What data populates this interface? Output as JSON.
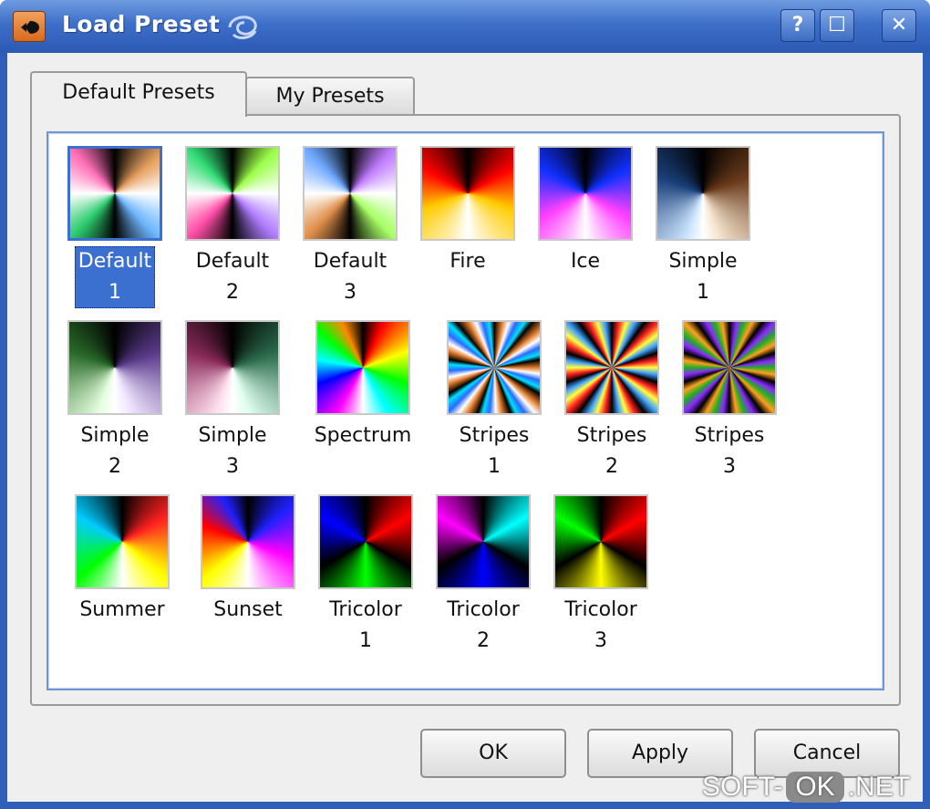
{
  "window": {
    "title": "Load Preset",
    "help_label": "?",
    "maximize_label": "☐",
    "close_label": "✕",
    "icons": [
      "app-icon",
      "swirl-icon"
    ]
  },
  "tabs": [
    {
      "label": "Default Presets",
      "active": true
    },
    {
      "label": "My Presets",
      "active": false
    }
  ],
  "presets": [
    {
      "name": "Default\n1",
      "selected": true,
      "gradient": "conic-gradient(from 0deg,#000 0deg,#e6a060 50deg,#fff 90deg,#6fb7ff 135deg,#000 180deg,#2ecc71 225deg,#fff 270deg,#ff6fb7 315deg,#000 360deg)"
    },
    {
      "name": "Default\n2",
      "selected": false,
      "gradient": "conic-gradient(from 0deg,#000 0deg,#9cff4a 45deg,#fff 90deg,#b07cff 135deg,#000 180deg,#ff4fa8 225deg,#fff 270deg,#33dd77 315deg,#000 360deg)"
    },
    {
      "name": "Default\n3",
      "selected": false,
      "gradient": "conic-gradient(from 0deg,#000 0deg,#c07cff 45deg,#fff 90deg,#a8ff66 135deg,#000 180deg,#e0904a 225deg,#fff 270deg,#6fa8ff 315deg,#000 360deg)"
    },
    {
      "name": "Fire",
      "selected": false,
      "gradient": "conic-gradient(from 0deg,#000 0deg,#ff0000 60deg,#ffcc00 110deg,#fff 180deg,#ffcc00 250deg,#ff0000 300deg,#000 360deg)"
    },
    {
      "name": "Ice",
      "selected": false,
      "gradient": "conic-gradient(from 0deg,#000 0deg,#1030ff 60deg,#ff40ff 120deg,#fff 180deg,#ff40ff 240deg,#1030ff 300deg,#000 360deg)"
    },
    {
      "name": "Simple\n1",
      "selected": false,
      "gradient": "conic-gradient(from 0deg,#000 0deg,#6a3a1a 70deg,#f6e6d0 160deg,#fff 180deg,#cde6ff 200deg,#1a3f7a 290deg,#000 360deg)"
    },
    {
      "name": "Simple\n2",
      "selected": false,
      "gradient": "conic-gradient(from 0deg,#000 0deg,#5a3a8a 70deg,#f0e6ff 160deg,#fff 180deg,#e6ffe0 200deg,#2a6a2a 290deg,#000 360deg)"
    },
    {
      "name": "Simple\n3",
      "selected": false,
      "gradient": "conic-gradient(from 0deg,#000 0deg,#2a6a4a 70deg,#e0fff0 160deg,#fff 180deg,#ffe0ee 200deg,#8a2a5a 290deg,#000 360deg)"
    },
    {
      "name": "Spectrum",
      "selected": false,
      "gradient": "conic-gradient(from 0deg,#000 0deg,#ff0000 25deg,#ffff00 70deg,#00ff00 110deg,#00ffff 150deg,#fff 180deg,#ff00ff 210deg,#0000ff 250deg,#00ffff 280deg,#00ff00 310deg,#ff8800 335deg,#000 360deg)"
    },
    {
      "name": "Stripes\n1",
      "selected": false,
      "gradient": "repeating-conic-gradient(from 0deg,#000 0deg,#e07a2a 10deg,#fff 18deg,#2a6aff 26deg,#00e0ff 34deg,#000 40deg)"
    },
    {
      "name": "Stripes\n2",
      "selected": false,
      "gradient": "repeating-conic-gradient(from 0deg,#000 0deg,#ff2020 9deg,#ffff40 18deg,#40a0ff 27deg,#000 36deg)"
    },
    {
      "name": "Stripes\n3",
      "selected": false,
      "gradient": "repeating-conic-gradient(from 0deg,#000 0deg,#8a2aff 9deg,#20b020 18deg,#ffa020 27deg,#000 36deg)"
    },
    {
      "name": "Summer",
      "selected": false,
      "gradient": "conic-gradient(from 0deg,#000 0deg,#ff2020 60deg,#ffff00 130deg,#fff 180deg,#00ff00 230deg,#00ccff 300deg,#000 360deg)"
    },
    {
      "name": "Sunset",
      "selected": false,
      "gradient": "conic-gradient(from 0deg,#000 0deg,#2020ff 50deg,#ff00ff 110deg,#fff 180deg,#ffff00 230deg,#ff0000 290deg,#2020ff 330deg,#000 360deg)"
    },
    {
      "name": "Tricolor\n1",
      "selected": false,
      "gradient": "conic-gradient(from 0deg,#000 0deg,#ff0000 60deg,#000 120deg,#00ff00 180deg,#000 240deg,#0000ff 300deg,#000 360deg)"
    },
    {
      "name": "Tricolor\n2",
      "selected": false,
      "gradient": "conic-gradient(from 0deg,#000 0deg,#00ffff 60deg,#000 120deg,#0000ff 180deg,#000 240deg,#ff00ff 300deg,#000 360deg)"
    },
    {
      "name": "Tricolor\n3",
      "selected": false,
      "gradient": "conic-gradient(from 0deg,#000 0deg,#ff0000 60deg,#000 120deg,#ffff00 180deg,#000 240deg,#00ff00 300deg,#000 360deg)"
    }
  ],
  "buttons": {
    "ok": "OK",
    "apply": "Apply",
    "cancel": "Cancel"
  },
  "watermark": {
    "left": "SOFT-",
    "mid": "OK",
    "right": ".NET"
  },
  "colors": {
    "titlebar": "#3d6fc9",
    "selection": "#3b6fd0"
  }
}
